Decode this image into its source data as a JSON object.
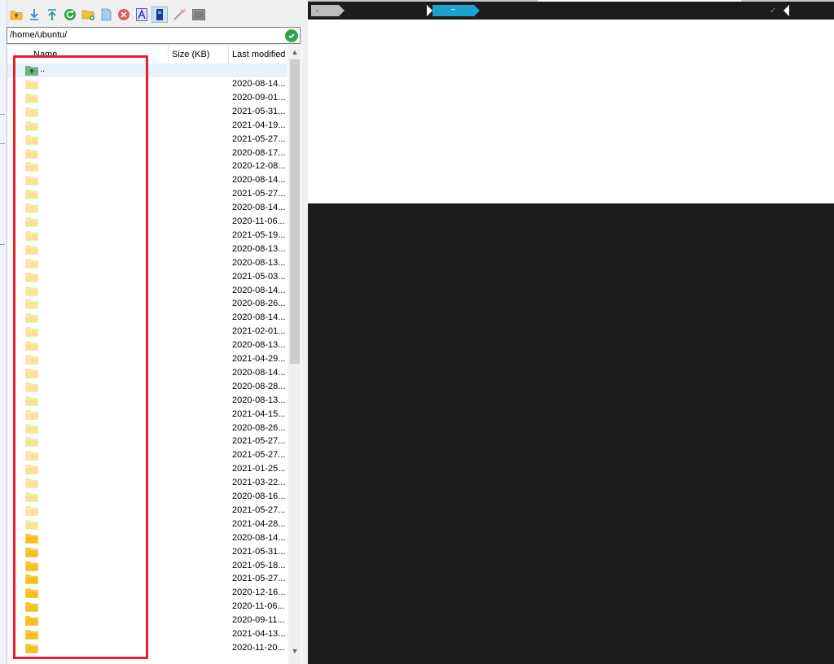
{
  "toolbar": {
    "buttons": [
      {
        "name": "parent-directory",
        "icon": "folder-up-icon",
        "color": "#f2c037"
      },
      {
        "name": "download",
        "icon": "download-icon",
        "color": "#3b82c4"
      },
      {
        "name": "upload",
        "icon": "upload-icon",
        "color": "#1f9c8a"
      },
      {
        "name": "refresh",
        "icon": "refresh-icon",
        "color": "#2ea44f"
      },
      {
        "name": "new-folder",
        "icon": "new-folder-icon",
        "color": "#f2c037"
      },
      {
        "name": "new-file",
        "icon": "new-file-icon",
        "color": "#7fb2e5"
      },
      {
        "name": "delete",
        "icon": "delete-icon",
        "color": "#e65b5b"
      },
      {
        "name": "rename",
        "icon": "rename-icon",
        "color": "#5b5fc7"
      },
      {
        "name": "toggle-hidden",
        "icon": "hidden-files-icon",
        "color": "#1e3a8a"
      },
      {
        "name": "permissions",
        "icon": "magic-wand-icon",
        "color": "#c45aa8"
      },
      {
        "name": "terminal",
        "icon": "terminal-icon",
        "color": "#8a8a8a"
      }
    ]
  },
  "path_bar": {
    "path": "/home/ubuntu/",
    "ok_icon": "check-circle-icon"
  },
  "file_list": {
    "columns": [
      "Name",
      "Size (KB)",
      "Last modified"
    ],
    "parent_label": "..",
    "rows": [
      {
        "date": "2020-08-14...",
        "icon": "folder-pale"
      },
      {
        "date": "2020-09-01...",
        "icon": "folder-pale"
      },
      {
        "date": "2021-05-31...",
        "icon": "folder-pale"
      },
      {
        "date": "2021-04-19...",
        "icon": "folder-pale"
      },
      {
        "date": "2021-05-27...",
        "icon": "folder-pale"
      },
      {
        "date": "2020-08-17...",
        "icon": "folder-pale"
      },
      {
        "date": "2020-12-08...",
        "icon": "folder-pale"
      },
      {
        "date": "2020-08-14...",
        "icon": "folder-pale"
      },
      {
        "date": "2021-05-27...",
        "icon": "folder-pale"
      },
      {
        "date": "2020-08-14...",
        "icon": "folder-pale"
      },
      {
        "date": "2020-11-06...",
        "icon": "folder-pale"
      },
      {
        "date": "2021-05-19...",
        "icon": "folder-pale"
      },
      {
        "date": "2020-08-13...",
        "icon": "folder-pale"
      },
      {
        "date": "2020-08-13...",
        "icon": "folder-pale"
      },
      {
        "date": "2021-05-03...",
        "icon": "folder-pale"
      },
      {
        "date": "2020-08-14...",
        "icon": "folder-pale"
      },
      {
        "date": "2020-08-26...",
        "icon": "folder-pale"
      },
      {
        "date": "2020-08-14...",
        "icon": "folder-pale"
      },
      {
        "date": "2021-02-01...",
        "icon": "folder-pale"
      },
      {
        "date": "2020-08-13...",
        "icon": "folder-pale"
      },
      {
        "date": "2021-04-29...",
        "icon": "folder-pale"
      },
      {
        "date": "2020-08-14...",
        "icon": "folder-pale"
      },
      {
        "date": "2020-08-28...",
        "icon": "folder-pale"
      },
      {
        "date": "2020-08-13...",
        "icon": "folder-pale"
      },
      {
        "date": "2021-04-15...",
        "icon": "folder-pale"
      },
      {
        "date": "2020-08-26...",
        "icon": "folder-pale"
      },
      {
        "date": "2021-05-27...",
        "icon": "folder-pale"
      },
      {
        "date": "2021-05-27...",
        "icon": "folder-pale"
      },
      {
        "date": "2021-01-25...",
        "icon": "folder-pale"
      },
      {
        "date": "2021-03-22...",
        "icon": "folder-pale"
      },
      {
        "date": "2020-08-16...",
        "icon": "folder-pale"
      },
      {
        "date": "2021-05-27...",
        "icon": "folder-pale"
      },
      {
        "date": "2021-04-28...",
        "icon": "folder-pale"
      },
      {
        "date": "2020-08-14...",
        "icon": "folder"
      },
      {
        "date": "2021-05-31...",
        "icon": "folder"
      },
      {
        "date": "2021-05-18...",
        "icon": "folder"
      },
      {
        "date": "2021-05-27...",
        "icon": "folder"
      },
      {
        "date": "2020-12-16...",
        "icon": "folder"
      },
      {
        "date": "2020-11-06...",
        "icon": "folder"
      },
      {
        "date": "2020-09-11...",
        "icon": "folder"
      },
      {
        "date": "2021-04-13...",
        "icon": "folder"
      },
      {
        "date": "2020-11-20...",
        "icon": "folder"
      }
    ]
  },
  "colors": {
    "folder": "#f4bf1f",
    "folder_pale": "#fbe29a",
    "highlight_box": "#e3202a",
    "terminal_bg": "#1c1c1c",
    "prompt_blue": "#1ba2d0",
    "path_ok_green": "#2ea44f"
  },
  "terminal": {
    "prompt_dir": "~",
    "status_mark": "✓"
  }
}
